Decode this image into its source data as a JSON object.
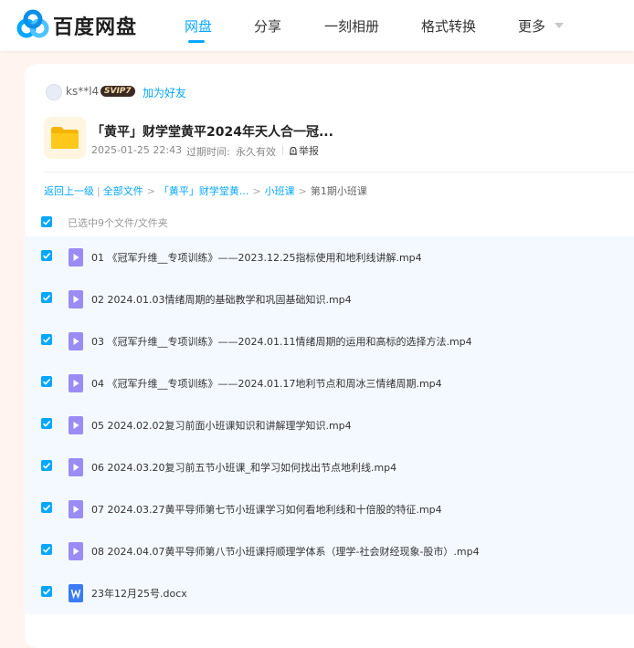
{
  "header": {
    "brand": "百度网盘",
    "nav": [
      "网盘",
      "分享",
      "一刻相册",
      "格式转换",
      "更多"
    ],
    "active_nav": "网盘",
    "accent_color": "#06a7ff"
  },
  "share": {
    "user": "ks**l4",
    "badge": "SVIP7",
    "add_friend": "加为好友",
    "title": "「黄平」财学堂黄平2024年天人合一冠...",
    "date": "2025-01-25 22:43",
    "expire_label": "过期时间:",
    "expire_value": "永久有效",
    "report": "举报"
  },
  "breadcrumb": {
    "back": "返回上一级",
    "items": [
      "全部文件",
      "「黄平」财学堂黄...",
      "小班课"
    ],
    "current": "第1期小班课"
  },
  "selection": {
    "label": "已选中9个文件/文件夹"
  },
  "files": [
    {
      "name": "01 《冠军升维__专项训练》——2023.12.25指标使用和地利线讲解.mp4",
      "type": "video",
      "checked": true
    },
    {
      "name": "02 2024.01.03情绪周期的基础教学和巩固基础知识.mp4",
      "type": "video",
      "checked": true
    },
    {
      "name": "03 《冠军升维__专项训练》——2024.01.11情绪周期的运用和高标的选择方法.mp4",
      "type": "video",
      "checked": true
    },
    {
      "name": "04 《冠军升维__专项训练》——2024.01.17地利节点和周冰三情绪周期.mp4",
      "type": "video",
      "checked": true
    },
    {
      "name": "05 2024.02.02复习前面小班课知识和讲解理学知识.mp4",
      "type": "video",
      "checked": true
    },
    {
      "name": "06 2024.03.20复习前五节小班课_和学习如何找出节点地利线.mp4",
      "type": "video",
      "checked": true
    },
    {
      "name": "07 2024.03.27黄平导师第七节小班课学习如何看地利线和十倍股的特征.mp4",
      "type": "video",
      "checked": true
    },
    {
      "name": "08 2024.04.07黄平导师第八节小班课捋顺理学体系（理学-社会财经现象-股市）.mp4",
      "type": "video",
      "checked": true
    },
    {
      "name": "23年12月25号.docx",
      "type": "docx",
      "checked": true
    }
  ],
  "icons": {
    "logo": "baidu-netdisk-cloud-icon",
    "folder": "folder-icon",
    "video": "video-file-icon",
    "docx": "word-file-icon",
    "report": "report-icon",
    "more": "chevron-down-icon"
  }
}
